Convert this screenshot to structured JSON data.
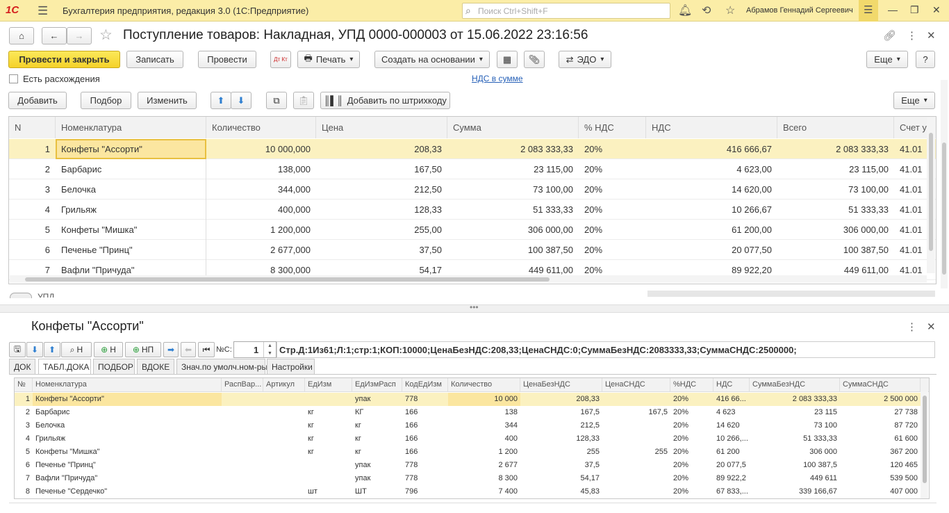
{
  "titlebar": {
    "logo": "1С",
    "app_title": "Бухгалтерия предприятия, редакция 3.0  (1С:Предприятие)",
    "search_placeholder": "Поиск Ctrl+Shift+F",
    "user": "Абрамов Геннадий Сергеевич"
  },
  "document": {
    "title": "Поступление товаров: Накладная, УПД 0000-000003 от 15.06.2022 23:16:56"
  },
  "toolbar": {
    "post_close": "Провести и закрыть",
    "save": "Записать",
    "post": "Провести",
    "dtkt": "Дт Кт",
    "print": "Печать",
    "create_based": "Создать на основании",
    "edo": "ЭДО",
    "more": "Еще",
    "help": "?"
  },
  "form": {
    "discrepancy_label": "Есть расхождения",
    "vat_link": "НДС в сумме",
    "upd_label": "УПД"
  },
  "table_toolbar": {
    "add": "Добавить",
    "pick": "Подбор",
    "edit": "Изменить",
    "barcode": "Добавить по штрихкоду",
    "more": "Еще"
  },
  "grid": {
    "columns": [
      "N",
      "Номенклатура",
      "Количество",
      "Цена",
      "Сумма",
      "% НДС",
      "НДС",
      "Всего",
      "Счет у"
    ],
    "rows": [
      [
        "1",
        "Конфеты \"Ассорти\"",
        "10 000,000",
        "208,33",
        "2 083 333,33",
        "20%",
        "416 666,67",
        "2 083 333,33",
        "41.01"
      ],
      [
        "2",
        "Барбарис",
        "138,000",
        "167,50",
        "23 115,00",
        "20%",
        "4 623,00",
        "23 115,00",
        "41.01"
      ],
      [
        "3",
        "Белочка",
        "344,000",
        "212,50",
        "73 100,00",
        "20%",
        "14 620,00",
        "73 100,00",
        "41.01"
      ],
      [
        "4",
        "Грильяж",
        "400,000",
        "128,33",
        "51 333,33",
        "20%",
        "10 266,67",
        "51 333,33",
        "41.01"
      ],
      [
        "5",
        "Конфеты \"Мишка\"",
        "1 200,000",
        "255,00",
        "306 000,00",
        "20%",
        "61 200,00",
        "306 000,00",
        "41.01"
      ],
      [
        "6",
        "Печенье \"Принц\"",
        "2 677,000",
        "37,50",
        "100 387,50",
        "20%",
        "20 077,50",
        "100 387,50",
        "41.01"
      ],
      [
        "7",
        "Вафли \"Причуда\"",
        "8 300,000",
        "54,17",
        "449 611,00",
        "20%",
        "89 922,20",
        "449 611,00",
        "41.01"
      ]
    ]
  },
  "bottom": {
    "title": "Конфеты \"Ассорти\"",
    "btn_n": "Н",
    "btn_np": "НП",
    "nc_label": "№С:",
    "nc_value": "1",
    "info": "Стр.Д:1Из61;Л:1;стр:1;КОП:10000;ЦенаБезНДС:208,33;ЦенаСНДС:0;СуммаБезНДС:2083333,33;СуммаСНДС:2500000;",
    "tabs": [
      "ДОК",
      "ТАБЛ.ДОКА",
      "ПОДБОР",
      "ВДОКЕ",
      "Знач.по умолч.ном-ры",
      "Настройки"
    ],
    "columns": [
      "№",
      "Номенклатура",
      "РаспВар...",
      "Артикул",
      "ЕдИзм",
      "ЕдИзмРасп",
      "КодЕдИзм",
      "Количество",
      "ЦенаБезНДС",
      "ЦенаСНДС",
      "%НДС",
      "НДС",
      "СуммаБезНДС",
      "СуммаСНДС"
    ],
    "rows": [
      [
        "1",
        "Конфеты \"Ассорти\"",
        "",
        "",
        "",
        "упак",
        "778",
        "10 000",
        "208,33",
        "",
        "20%",
        "416 66...",
        "2 083 333,33",
        "2 500 000"
      ],
      [
        "2",
        "Барбарис",
        "",
        "",
        "кг",
        "КГ",
        "166",
        "138",
        "167,5",
        "167,5",
        "20%",
        "4 623",
        "23 115",
        "27 738"
      ],
      [
        "3",
        "Белочка",
        "",
        "",
        "кг",
        "кг",
        "166",
        "344",
        "212,5",
        "",
        "20%",
        "14 620",
        "73 100",
        "87 720"
      ],
      [
        "4",
        "Грильяж",
        "",
        "",
        "кг",
        "кг",
        "166",
        "400",
        "128,33",
        "",
        "20%",
        "10 266,...",
        "51 333,33",
        "61 600"
      ],
      [
        "5",
        "Конфеты \"Мишка\"",
        "",
        "",
        "кг",
        "кг",
        "166",
        "1 200",
        "255",
        "255",
        "20%",
        "61 200",
        "306 000",
        "367 200"
      ],
      [
        "6",
        "Печенье \"Принц\"",
        "",
        "",
        "",
        "упак",
        "778",
        "2 677",
        "37,5",
        "",
        "20%",
        "20 077,5",
        "100 387,5",
        "120 465"
      ],
      [
        "7",
        "Вафли \"Причуда\"",
        "",
        "",
        "",
        "упак",
        "778",
        "8 300",
        "54,17",
        "",
        "20%",
        "89 922,2",
        "449 611",
        "539 500"
      ],
      [
        "8",
        "Печенье \"Сердечко\"",
        "",
        "",
        "шт",
        "ШТ",
        "796",
        "7 400",
        "45,83",
        "",
        "20%",
        "67 833,...",
        "339 166,67",
        "407 000"
      ]
    ]
  },
  "colors": {
    "titlebar_bg": "#fbeda7",
    "primary_button": "#f5d22a",
    "selected_row": "#fbf1c0",
    "link": "#2660b7"
  }
}
